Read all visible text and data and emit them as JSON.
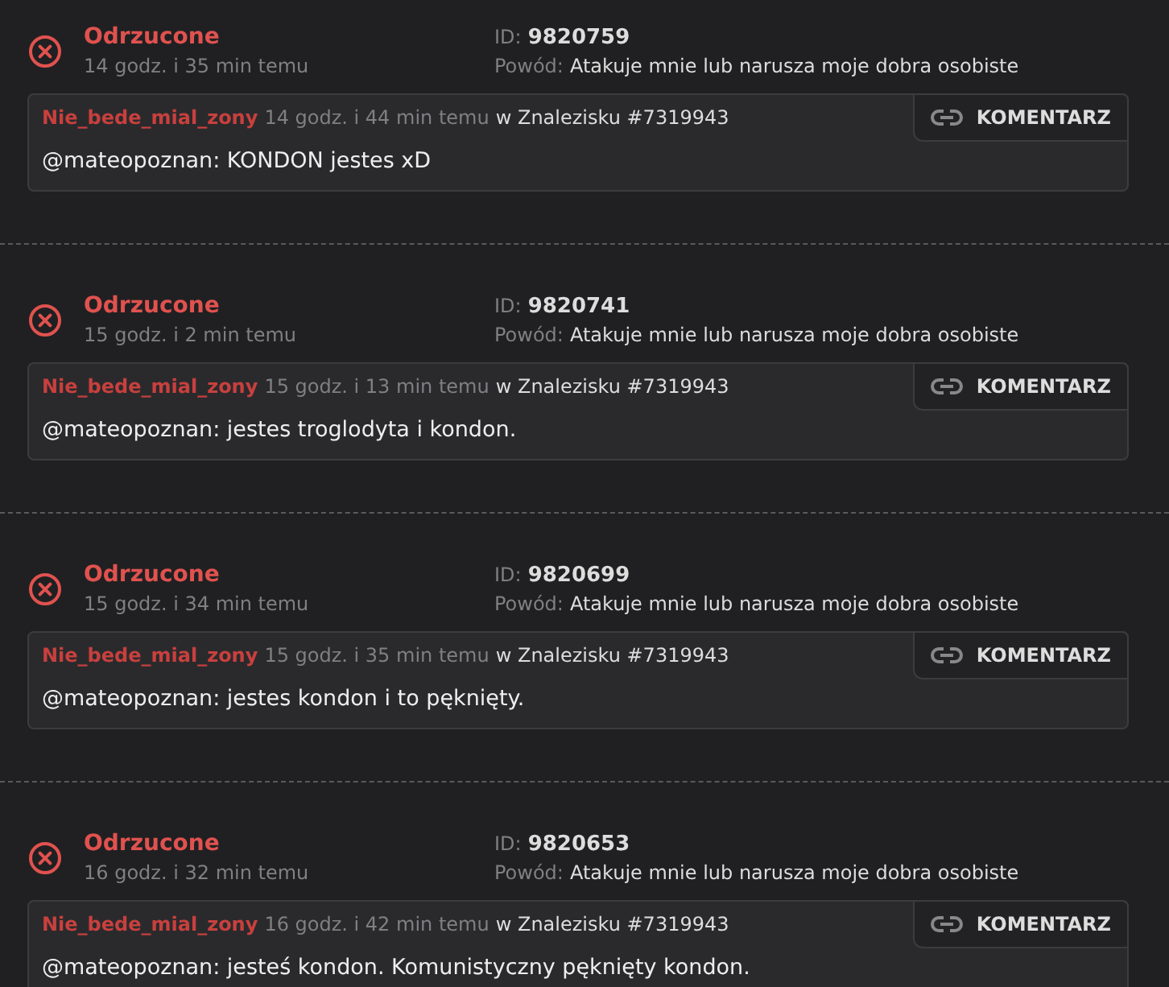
{
  "reports": [
    {
      "status": {
        "kind": "rejected",
        "label": "Odrzucone"
      },
      "time": "14 godz. i 35 min temu",
      "id_label": "ID:",
      "id": "9820759",
      "reason_label": "Powód:",
      "reason": "Atakuje mnie lub narusza moje dobra osobiste",
      "comment": {
        "author": "Nie_bede_mial_zony",
        "time": "14 godz. i 44 min temu",
        "where": "w Znalezisku #7319943",
        "text": "@mateopoznan: KONDON jestes xD",
        "button": "KOMENTARZ"
      }
    },
    {
      "status": {
        "kind": "rejected",
        "label": "Odrzucone"
      },
      "time": "15 godz. i 2 min temu",
      "id_label": "ID:",
      "id": "9820741",
      "reason_label": "Powód:",
      "reason": "Atakuje mnie lub narusza moje dobra osobiste",
      "comment": {
        "author": "Nie_bede_mial_zony",
        "time": "15 godz. i 13 min temu",
        "where": "w Znalezisku #7319943",
        "text": "@mateopoznan: jestes troglodyta i kondon.",
        "button": "KOMENTARZ"
      }
    },
    {
      "status": {
        "kind": "rejected",
        "label": "Odrzucone"
      },
      "time": "15 godz. i 34 min temu",
      "id_label": "ID:",
      "id": "9820699",
      "reason_label": "Powód:",
      "reason": "Atakuje mnie lub narusza moje dobra osobiste",
      "comment": {
        "author": "Nie_bede_mial_zony",
        "time": "15 godz. i 35 min temu",
        "where": "w Znalezisku #7319943",
        "text": "@mateopoznan: jestes kondon i to pęknięty.",
        "button": "KOMENTARZ"
      }
    },
    {
      "status": {
        "kind": "rejected",
        "label": "Odrzucone"
      },
      "time": "16 godz. i 32 min temu",
      "id_label": "ID:",
      "id": "9820653",
      "reason_label": "Powód:",
      "reason": "Atakuje mnie lub narusza moje dobra osobiste",
      "comment": {
        "author": "Nie_bede_mial_zony",
        "time": "16 godz. i 42 min temu",
        "where": "w Znalezisku #7319943",
        "text": "@mateopoznan: jesteś kondon. Komunistyczny pęknięty kondon.",
        "button": "KOMENTARZ"
      }
    }
  ]
}
